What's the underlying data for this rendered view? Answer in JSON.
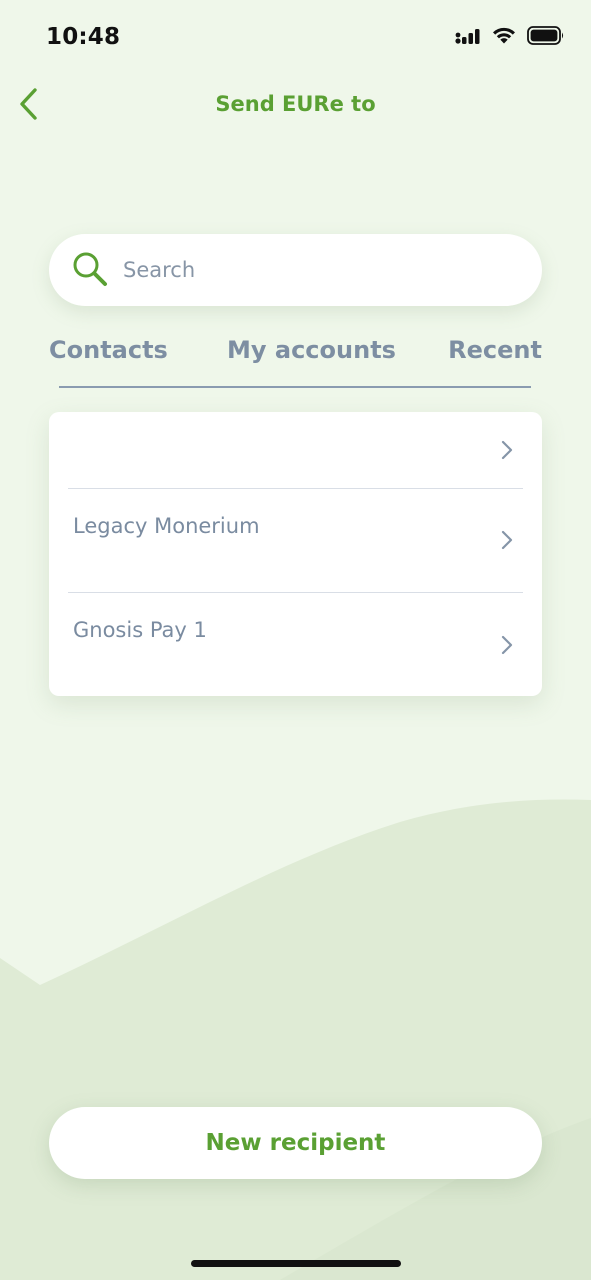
{
  "status_bar": {
    "time": "10:48",
    "icons": [
      "signal-icon",
      "wifi-icon",
      "battery-icon"
    ]
  },
  "header": {
    "back_icon": "chevron-left-icon",
    "title": "Send EURe to"
  },
  "search": {
    "icon": "search-icon",
    "placeholder": "Search",
    "value": ""
  },
  "tabs": [
    {
      "label": "Contacts"
    },
    {
      "label": "My accounts"
    },
    {
      "label": "Recent"
    }
  ],
  "list": {
    "items": [
      {
        "label": ""
      },
      {
        "label": "Legacy Monerium"
      },
      {
        "label": "Gnosis Pay 1"
      }
    ],
    "chevron_icon": "chevron-right-icon"
  },
  "actions": {
    "new_recipient_label": "New recipient"
  },
  "colors": {
    "accent": "#5aa033",
    "tab_text": "#7d8ea2",
    "item_text": "#7a8ba0",
    "background": "#eff7ea"
  }
}
